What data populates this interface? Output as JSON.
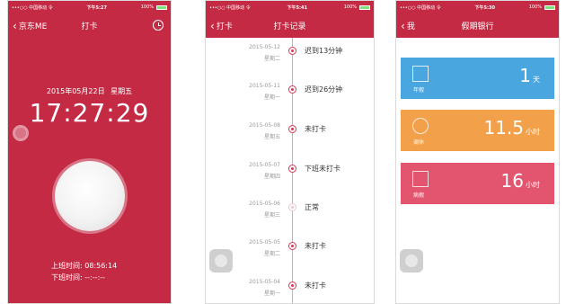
{
  "status_bar": {
    "p1": {
      "carrier": "•••○○ 中国移动 令",
      "time": "下午5:27",
      "battery": "100%"
    },
    "p2": {
      "carrier": "•••○○ 中国移动 令",
      "time": "下午5:41",
      "battery": "100%"
    },
    "p3": {
      "carrier": "•••○○ 中国移动 令",
      "time": "下午5:30",
      "battery": "100%"
    }
  },
  "panel1": {
    "back_label": "京东ME",
    "title": "打卡",
    "date": "2015年05月22日",
    "weekday": "星期五",
    "clock": "17:27:29",
    "checkin_line": "上班时间: 08:56:14",
    "checkout_line": "下班时间: --:--:--"
  },
  "panel2": {
    "back_label": "打卡",
    "title": "打卡记录",
    "records": [
      {
        "date": "2015-05-12",
        "weekday": "星期二",
        "status": "迟到13分钟",
        "state": "alert"
      },
      {
        "date": "2015-05-11",
        "weekday": "星期一",
        "status": "迟到26分钟",
        "state": "alert"
      },
      {
        "date": "2015-05-08",
        "weekday": "星期五",
        "status": "未打卡",
        "state": "alert"
      },
      {
        "date": "2015-05-07",
        "weekday": "星期四",
        "status": "下班未打卡",
        "state": "alert"
      },
      {
        "date": "2015-05-06",
        "weekday": "星期三",
        "status": "正常",
        "state": "ok"
      },
      {
        "date": "2015-05-05",
        "weekday": "星期二",
        "status": "未打卡",
        "state": "alert"
      },
      {
        "date": "2015-05-04",
        "weekday": "星期一",
        "status": "未打卡",
        "state": "alert"
      }
    ]
  },
  "panel3": {
    "back_label": "我",
    "title": "假期银行",
    "cards": [
      {
        "label": "年假",
        "value": "1",
        "unit": "天",
        "color": "#4aa6df",
        "icon": "calendar-icon"
      },
      {
        "label": "调休",
        "value": "11.5",
        "unit": "小时",
        "color": "#f2a04a",
        "icon": "clock-icon"
      },
      {
        "label": "病假",
        "value": "16",
        "unit": "小时",
        "color": "#e3546f",
        "icon": "medkit-icon"
      }
    ]
  },
  "colors": {
    "primary": "#c42a44",
    "alert_dot": "#d33a52"
  }
}
